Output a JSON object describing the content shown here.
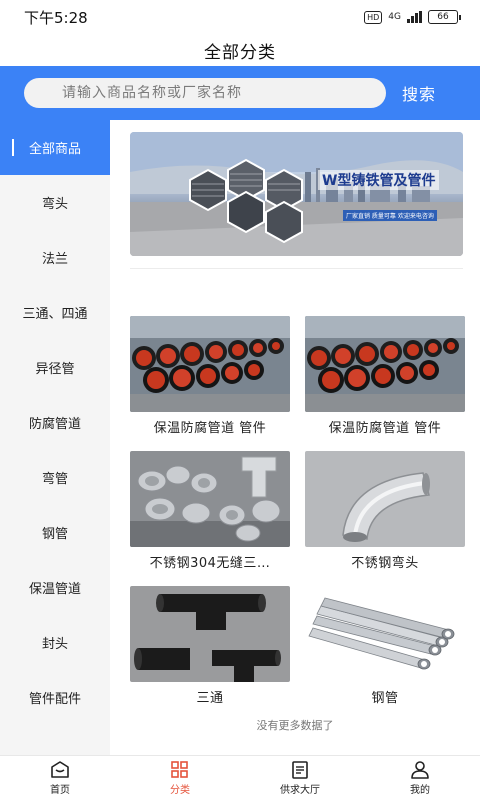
{
  "status_bar": {
    "time": "下午5:28",
    "hd": "HD",
    "network": "4G",
    "battery": "66"
  },
  "page_title": "全部分类",
  "search": {
    "placeholder": "请输入商品名称或厂家名称",
    "button_label": "搜索"
  },
  "sidebar": {
    "items": [
      {
        "label": "全部商品",
        "active": true
      },
      {
        "label": "弯头"
      },
      {
        "label": "法兰"
      },
      {
        "label": "三通、四通"
      },
      {
        "label": "异径管"
      },
      {
        "label": "防腐管道"
      },
      {
        "label": "弯管"
      },
      {
        "label": "钢管"
      },
      {
        "label": "保温管道"
      },
      {
        "label": "封头"
      },
      {
        "label": "管件配件"
      }
    ]
  },
  "banner": {
    "title": "W型铸铁管及管件",
    "subtitle": "厂家直销 质量可靠 欢迎来电咨询"
  },
  "products": [
    {
      "name": "保温防腐管道 管件"
    },
    {
      "name": "保温防腐管道 管件"
    },
    {
      "name": "不锈钢304无缝三…"
    },
    {
      "name": "不锈钢弯头"
    },
    {
      "name": "三通"
    },
    {
      "name": "钢管"
    }
  ],
  "footer_text": "没有更多数据了",
  "tabs": [
    {
      "label": "首页"
    },
    {
      "label": "分类",
      "active": true
    },
    {
      "label": "供求大厅"
    },
    {
      "label": "我的"
    }
  ],
  "colors": {
    "accent": "#3b82f6",
    "tab_active": "#e5533b"
  }
}
